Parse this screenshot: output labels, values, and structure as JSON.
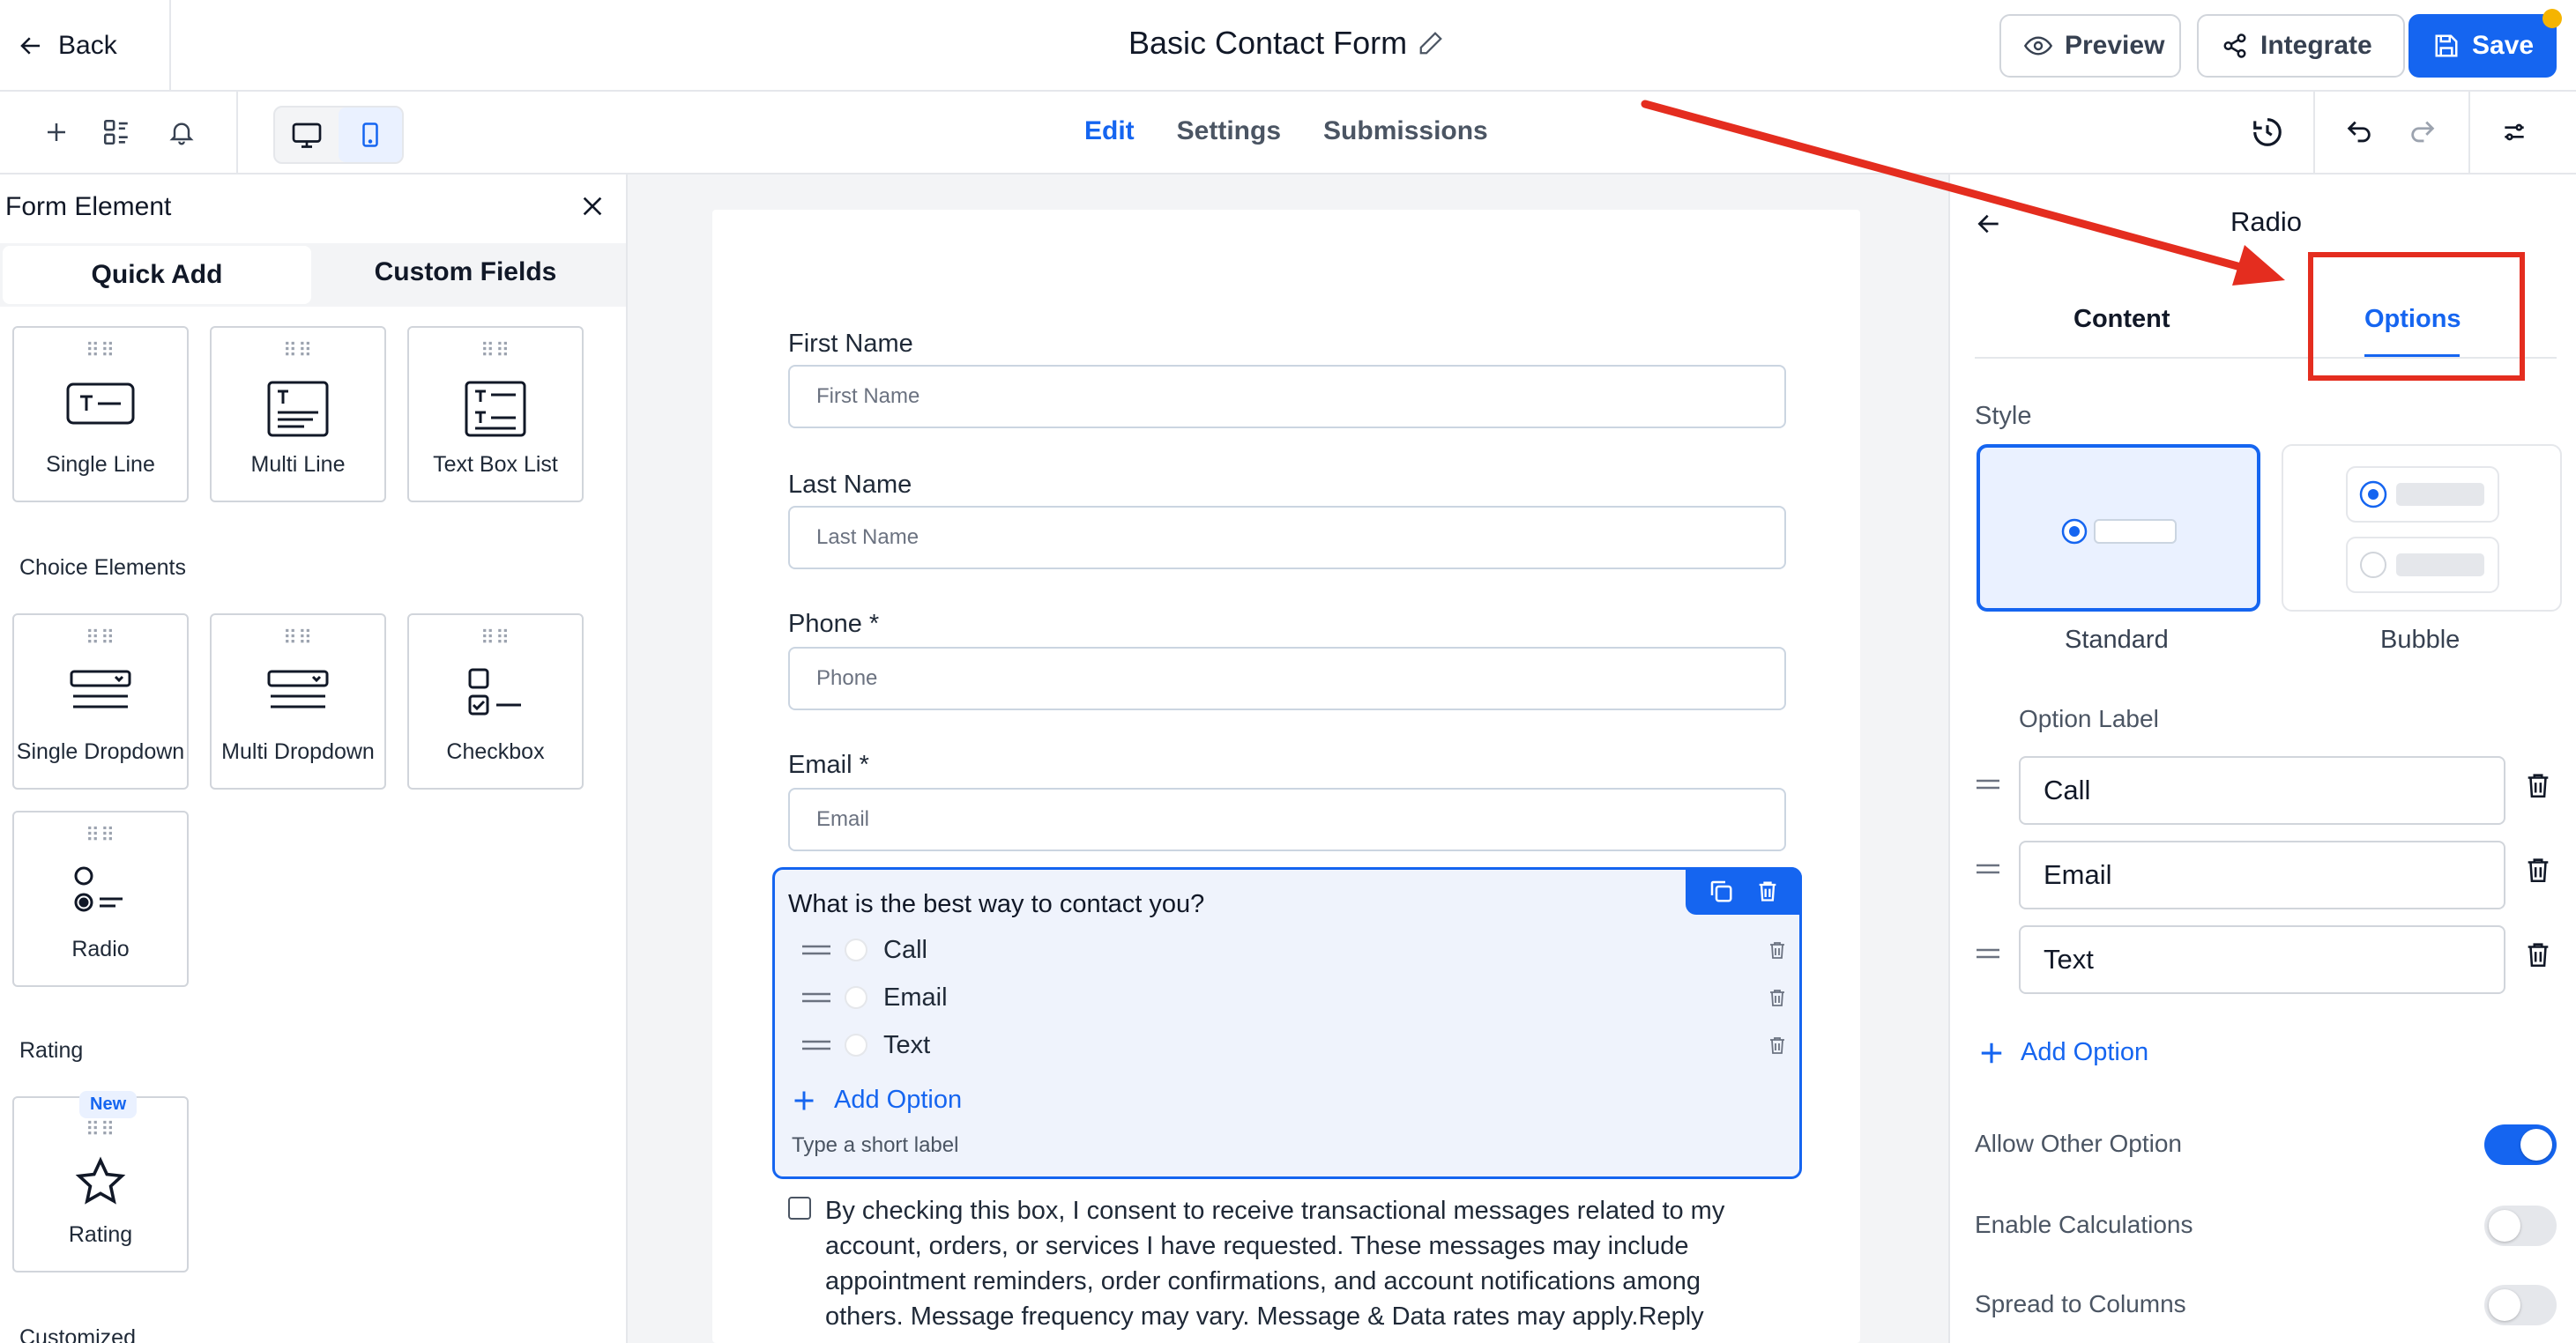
{
  "header": {
    "back_label": "Back",
    "form_title": "Basic Contact Form",
    "preview_label": "Preview",
    "integrate_label": "Integrate",
    "save_label": "Save"
  },
  "toolbar": {
    "tabs": [
      {
        "label": "Edit",
        "active": true
      },
      {
        "label": "Settings",
        "active": false
      },
      {
        "label": "Submissions",
        "active": false
      }
    ],
    "device": "desktop"
  },
  "left_panel": {
    "title": "Form Element",
    "tabs": [
      {
        "label": "Quick Add",
        "active": true
      },
      {
        "label": "Custom Fields",
        "active": false
      }
    ],
    "text_elements": [
      {
        "label": "Single Line",
        "icon": "single-line-icon"
      },
      {
        "label": "Multi Line",
        "icon": "multi-line-icon"
      },
      {
        "label": "Text Box List",
        "icon": "text-box-list-icon"
      }
    ],
    "choice_section_title": "Choice Elements",
    "choice_elements": [
      {
        "label": "Single Dropdown",
        "icon": "single-dropdown-icon"
      },
      {
        "label": "Multi Dropdown",
        "icon": "multi-dropdown-icon"
      },
      {
        "label": "Checkbox",
        "icon": "checkbox-icon"
      },
      {
        "label": "Radio",
        "icon": "radio-icon"
      }
    ],
    "rating_section_title": "Rating",
    "rating_element": {
      "label": "Rating",
      "badge": "New",
      "icon": "star-icon"
    },
    "customized_section_title": "Customized"
  },
  "form": {
    "fields": [
      {
        "label": "First Name",
        "placeholder": "First Name"
      },
      {
        "label": "Last Name",
        "placeholder": "Last Name"
      },
      {
        "label": "Phone *",
        "placeholder": "Phone"
      },
      {
        "label": "Email *",
        "placeholder": "Email"
      }
    ],
    "radio": {
      "question": "What is the best way to contact you?",
      "options": [
        "Call",
        "Email",
        "Text"
      ],
      "add_option_label": "Add Option",
      "hint": "Type a short label"
    },
    "consent_text": "By checking this box, I consent to receive transactional messages related to my account, orders, or services I have requested. These messages may include appointment reminders, order confirmations, and account notifications among others. Message frequency may vary. Message & Data rates may apply.Reply"
  },
  "right_panel": {
    "title": "Radio",
    "tabs": [
      {
        "label": "Content",
        "active": false
      },
      {
        "label": "Options",
        "active": true
      }
    ],
    "style_label": "Style",
    "styles": [
      {
        "name": "Standard",
        "selected": true
      },
      {
        "name": "Bubble",
        "selected": false
      }
    ],
    "option_label_title": "Option Label",
    "options": [
      "Call",
      "Email",
      "Text"
    ],
    "add_option_label": "Add Option",
    "toggles": [
      {
        "label": "Allow Other Option",
        "on": true
      },
      {
        "label": "Enable Calculations",
        "on": false
      },
      {
        "label": "Spread to Columns",
        "on": false
      }
    ]
  },
  "colors": {
    "accent": "#1565f0",
    "annotation": "#e42d1f",
    "badge": "#f5b400"
  }
}
